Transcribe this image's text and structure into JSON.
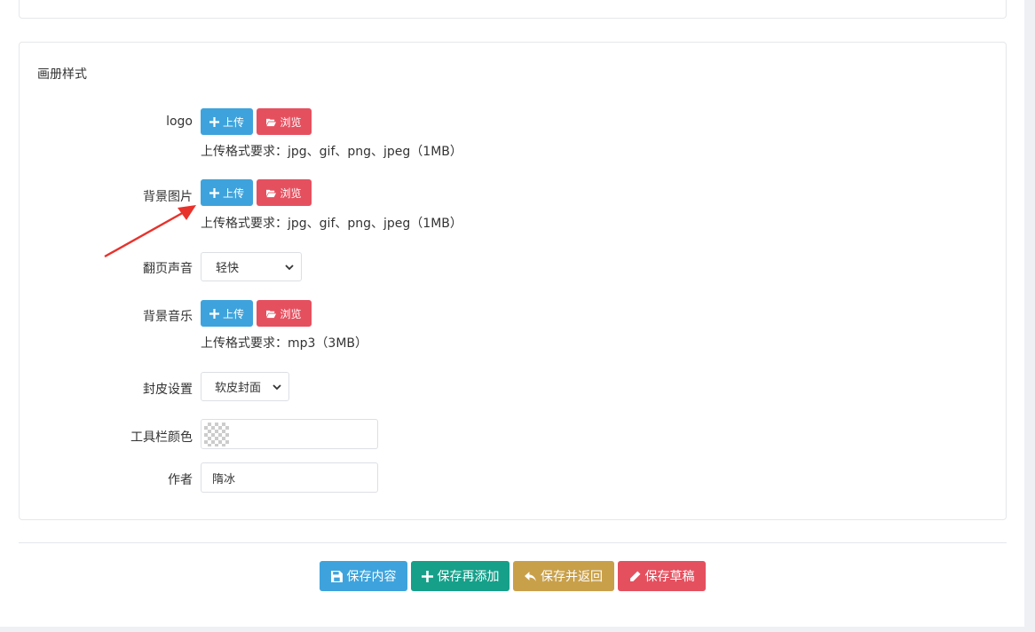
{
  "section": {
    "title": "画册样式"
  },
  "buttons": {
    "upload_label": "上传",
    "browse_label": "浏览"
  },
  "fields": {
    "logo": {
      "label": "logo",
      "hint": "上传格式要求：jpg、gif、png、jpeg（1MB）"
    },
    "background_image": {
      "label": "背景图片",
      "hint": "上传格式要求：jpg、gif、png、jpeg（1MB）"
    },
    "page_sound": {
      "label": "翻页声音",
      "selected": "轻快"
    },
    "background_music": {
      "label": "背景音乐",
      "hint": "上传格式要求：mp3（3MB）"
    },
    "cover_setting": {
      "label": "封皮设置",
      "selected": "软皮封面"
    },
    "toolbar_color": {
      "label": "工具栏颜色",
      "value": ""
    },
    "author": {
      "label": "作者",
      "value": "隋冰"
    }
  },
  "actions": {
    "save_content": "保存内容",
    "save_and_add": "保存再添加",
    "save_and_return": "保存并返回",
    "save_draft": "保存草稿"
  },
  "colors": {
    "upload": "#3ea3dc",
    "browse": "#e5505f",
    "save_content": "#3ea3dc",
    "save_and_add": "#16a08a",
    "save_and_return": "#c9a04a",
    "save_draft": "#e5505f",
    "annotation_arrow": "#e8322c"
  },
  "icons": {
    "upload": "plus-icon",
    "browse": "folder-open-icon",
    "save_content": "floppy-disk-icon",
    "save_and_add": "plus-icon",
    "save_and_return": "reply-icon",
    "save_draft": "pencil-icon"
  }
}
